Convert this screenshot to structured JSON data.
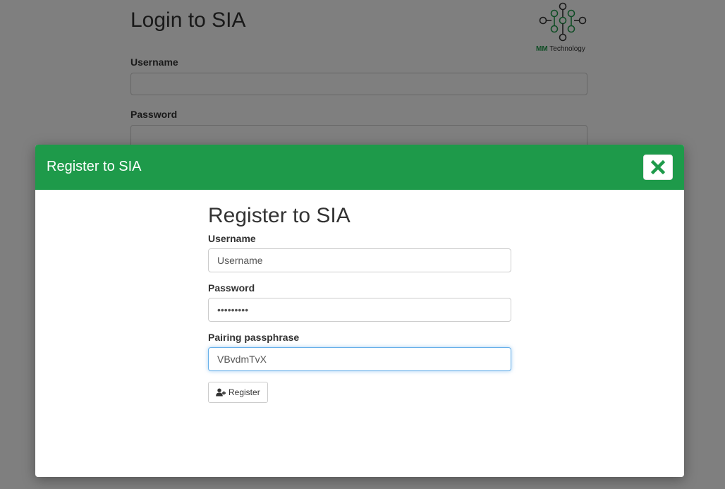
{
  "background": {
    "title": "Login to SIA",
    "username_label": "Username",
    "password_label": "Password",
    "logo": {
      "brand": "MM",
      "name": "Technology"
    }
  },
  "modal": {
    "header_title": "Register to SIA",
    "close_icon": "close-icon",
    "form_title": "Register to SIA",
    "username": {
      "label": "Username",
      "placeholder": "Username",
      "value": ""
    },
    "password": {
      "label": "Password",
      "value": "•••••••••"
    },
    "passphrase": {
      "label": "Pairing passphrase",
      "value": "VBvdmTvX"
    },
    "register_button": {
      "label": "Register",
      "icon": "user-plus-icon"
    }
  },
  "colors": {
    "accent": "#1e9a4a",
    "focus": "#66afe9"
  }
}
